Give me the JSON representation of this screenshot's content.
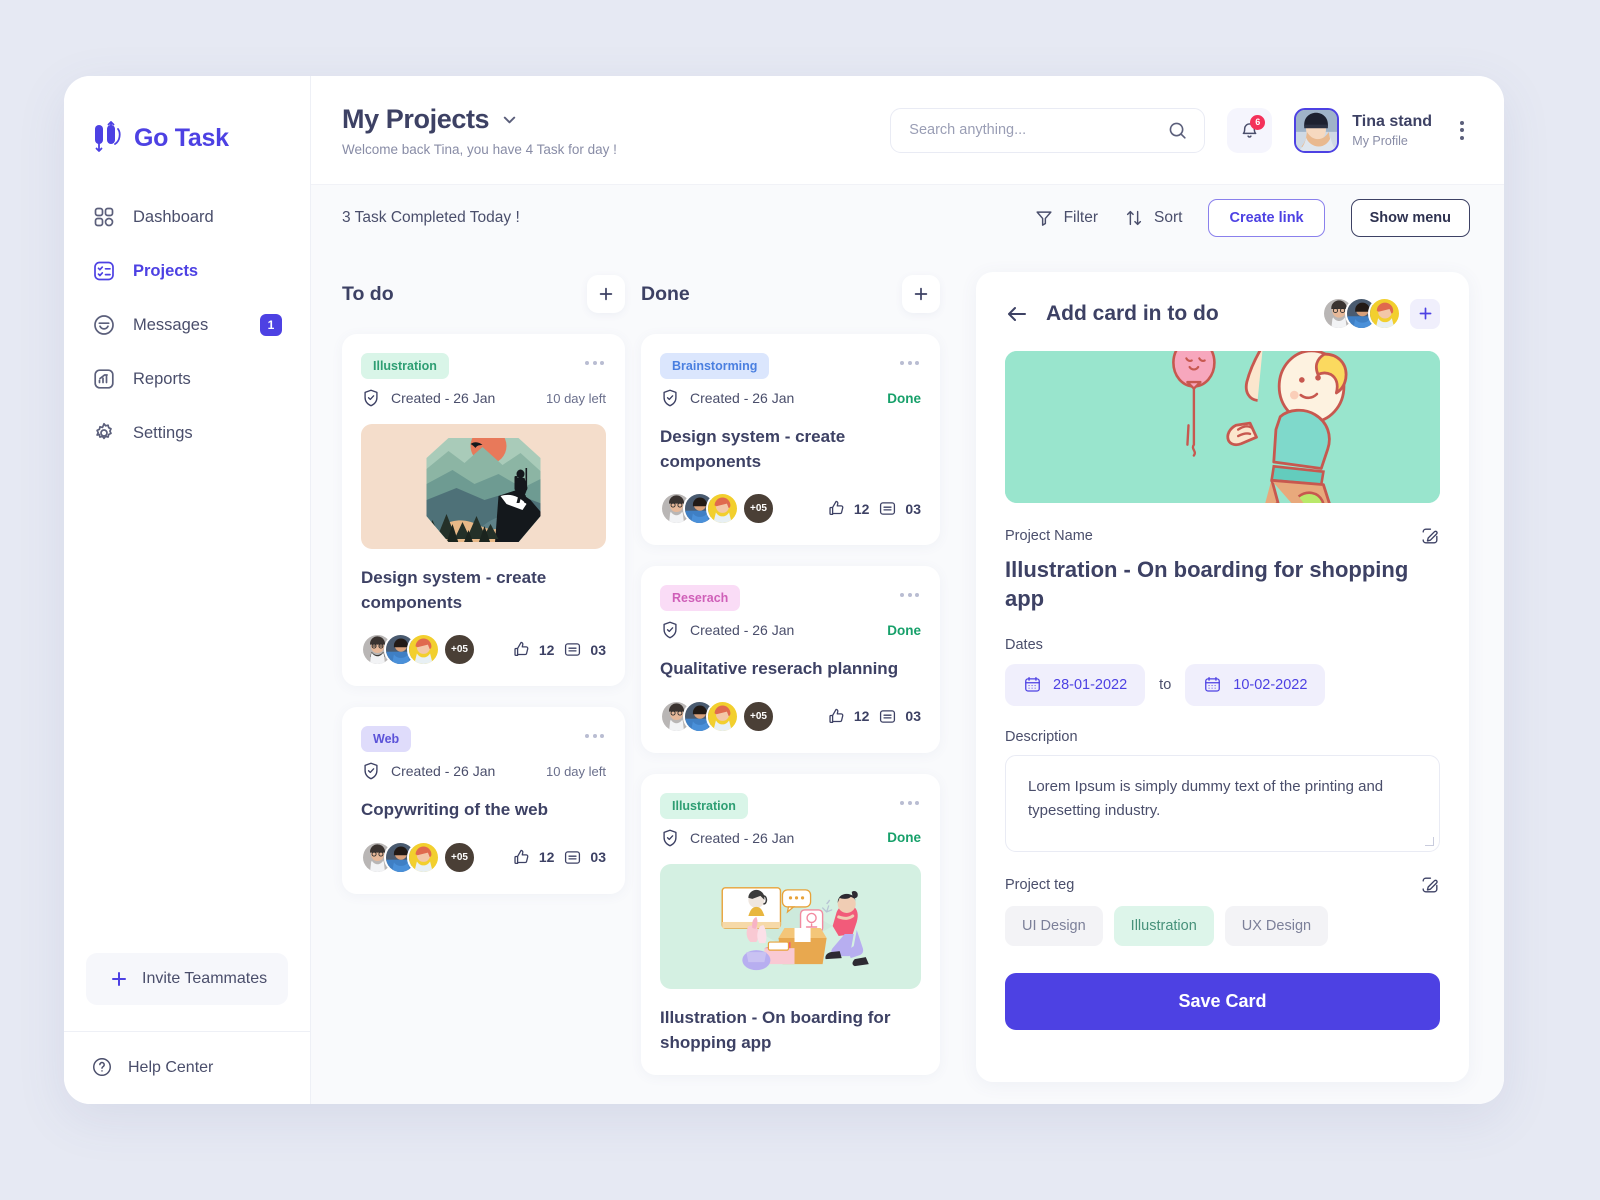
{
  "brand": {
    "name": "Go Task",
    "logo_icon": "go-task-logo-icon"
  },
  "sidebar": {
    "items": [
      {
        "label": "Dashboard",
        "icon": "dashboard-grid-icon",
        "active": false,
        "badge": ""
      },
      {
        "label": "Projects",
        "icon": "projects-checklist-icon",
        "active": true,
        "badge": ""
      },
      {
        "label": "Messages",
        "icon": "messages-inbox-icon",
        "active": false,
        "badge": "1"
      },
      {
        "label": "Reports",
        "icon": "reports-chart-icon",
        "active": false,
        "badge": ""
      },
      {
        "label": "Settings",
        "icon": "settings-gear-icon",
        "active": false,
        "badge": ""
      }
    ],
    "invite_label": "Invite Teammates",
    "invite_icon": "plus-icon",
    "help_label": "Help Center",
    "help_icon": "question-circle-icon"
  },
  "header": {
    "title": "My Projects",
    "title_chevron_icon": "chevron-down-icon",
    "subtitle": "Welcome back Tina, you have 4 Task for day !",
    "search": {
      "value": "",
      "placeholder": "Search anything...",
      "icon": "search-icon"
    },
    "notifications": {
      "icon": "bell-icon",
      "count": "6"
    },
    "profile": {
      "name": "Tina stand",
      "role": "My Profile",
      "avatar": "user-avatar"
    },
    "overflow_icon": "kebab-vertical-icon"
  },
  "toolbar": {
    "note": "3 Task Completed Today !",
    "filter_label": "Filter",
    "filter_icon": "filter-funnel-icon",
    "sort_label": "Sort",
    "sort_icon": "sort-arrows-icon",
    "create_link_label": "Create link",
    "show_menu_label": "Show menu"
  },
  "board": {
    "columns": [
      {
        "title": "To do",
        "add_icon": "plus-icon",
        "cards": [
          {
            "tag": "Illustration",
            "tag_style": "illustration",
            "created": "Created - 26 Jan",
            "created_icon": "shield-check-icon",
            "status": "10 day left",
            "status_done": false,
            "thumb": "mountain-hiker-illustration",
            "title": "Design system - create components",
            "avatars_more": "+05",
            "likes": "12",
            "likes_icon": "thumbs-up-icon",
            "comments": "03",
            "comments_icon": "comment-lines-icon"
          },
          {
            "tag": "Web",
            "tag_style": "web",
            "created": "Created - 26 Jan",
            "created_icon": "shield-check-icon",
            "status": "10 day left",
            "status_done": false,
            "thumb": "",
            "title": "Copywriting of the web",
            "avatars_more": "+05",
            "likes": "12",
            "likes_icon": "thumbs-up-icon",
            "comments": "03",
            "comments_icon": "comment-lines-icon"
          }
        ]
      },
      {
        "title": "Done",
        "add_icon": "plus-icon",
        "cards": [
          {
            "tag": "Brainstorming",
            "tag_style": "brainstorming",
            "created": "Created - 26 Jan",
            "created_icon": "shield-check-icon",
            "status": "Done",
            "status_done": true,
            "thumb": "",
            "title": "Design system - create components",
            "avatars_more": "+05",
            "likes": "12",
            "likes_icon": "thumbs-up-icon",
            "comments": "03",
            "comments_icon": "comment-lines-icon"
          },
          {
            "tag": "Reserach",
            "tag_style": "research",
            "created": "Created - 26 Jan",
            "created_icon": "shield-check-icon",
            "status": "Done",
            "status_done": true,
            "thumb": "",
            "title": "Qualitative reserach planning",
            "avatars_more": "+05",
            "likes": "12",
            "likes_icon": "thumbs-up-icon",
            "comments": "03",
            "comments_icon": "comment-lines-icon"
          },
          {
            "tag": "Illustration",
            "tag_style": "illustration",
            "created": "Created - 26 Jan",
            "created_icon": "shield-check-icon",
            "status": "Done",
            "status_done": true,
            "thumb": "shopping-onboarding-illustration",
            "title": "Illustration - On boarding for shopping app",
            "avatars_more": "+05",
            "likes": "12",
            "likes_icon": "thumbs-up-icon",
            "comments": "03",
            "comments_icon": "comment-lines-icon"
          }
        ]
      }
    ]
  },
  "panel": {
    "back_icon": "arrow-left-icon",
    "title": "Add card in to do",
    "add_member_icon": "plus-icon",
    "hero_image": "running-person-balloon-illustration",
    "project_name_label": "Project Name",
    "project_name_edit_icon": "edit-pencil-icon",
    "project_name": "Illustration - On boarding for shopping app",
    "dates_label": "Dates",
    "date_start": "28-01-2022",
    "date_end": "10-02-2022",
    "date_icon": "calendar-icon",
    "date_separator": "to",
    "description_label": "Description",
    "description": "Lorem Ipsum is simply dummy text of the printing and typesetting industry.",
    "project_tag_label": "Project teg",
    "project_tag_edit_icon": "edit-pencil-icon",
    "tags": [
      {
        "label": "UI Design",
        "selected": false
      },
      {
        "label": "Illustration",
        "selected": true
      },
      {
        "label": "UX Design",
        "selected": false
      }
    ],
    "save_label": "Save Card"
  },
  "colors": {
    "accent": "#4d41e3",
    "page_bg": "#e6e9f3",
    "board_bg": "#f9fafc",
    "done_green": "#17a06a",
    "badge_red": "#f4315a"
  }
}
